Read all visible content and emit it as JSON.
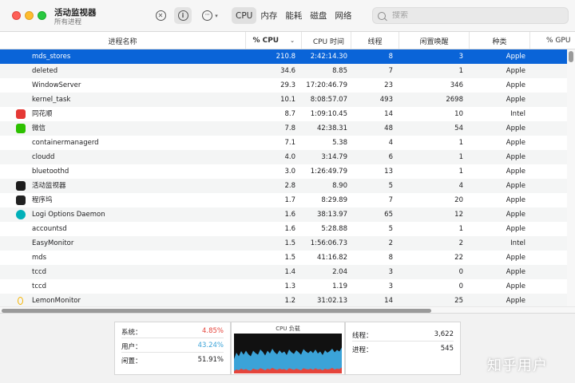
{
  "window": {
    "title": "活动监视器",
    "subtitle": "所有进程"
  },
  "toolbar": {
    "stop_icon": "xmark-circle-icon",
    "info_icon": "info-circle-icon",
    "more_icon": "ellipsis-circle-icon",
    "stop_glyph": "✕",
    "info_glyph": "i",
    "more_glyph": "···",
    "chevron": "▾"
  },
  "tabs": [
    {
      "label": "CPU",
      "active": true
    },
    {
      "label": "内存",
      "active": false
    },
    {
      "label": "能耗",
      "active": false
    },
    {
      "label": "磁盘",
      "active": false
    },
    {
      "label": "网络",
      "active": false
    }
  ],
  "search": {
    "placeholder": "搜索"
  },
  "columns": {
    "name": "进程名称",
    "cpu": "% CPU",
    "cpu_sort": "⌄",
    "cpu_time": "CPU 时间",
    "threads": "线程",
    "idle_wakeups": "闲置唤醒",
    "kind": "种类",
    "gpu": "% GPU"
  },
  "processes": [
    {
      "name": "mds_stores",
      "icon": "",
      "cpu": "210.8",
      "time": "2:42:14.30",
      "threads": "8",
      "wakeups": "3",
      "kind": "Apple",
      "selected": true
    },
    {
      "name": "deleted",
      "icon": "",
      "cpu": "34.6",
      "time": "8.85",
      "threads": "7",
      "wakeups": "1",
      "kind": "Apple"
    },
    {
      "name": "WindowServer",
      "icon": "",
      "cpu": "29.3",
      "time": "17:20:46.79",
      "threads": "23",
      "wakeups": "346",
      "kind": "Apple"
    },
    {
      "name": "kernel_task",
      "icon": "",
      "cpu": "10.1",
      "time": "8:08:57.07",
      "threads": "493",
      "wakeups": "2698",
      "kind": "Apple"
    },
    {
      "name": "同花顺",
      "icon": "tonghuashun-icon",
      "cpu": "8.7",
      "time": "1:09:10.45",
      "threads": "14",
      "wakeups": "10",
      "kind": "Intel"
    },
    {
      "name": "微信",
      "icon": "wechat-icon",
      "cpu": "7.8",
      "time": "42:38.31",
      "threads": "48",
      "wakeups": "54",
      "kind": "Apple"
    },
    {
      "name": "containermanagerd",
      "icon": "",
      "cpu": "7.1",
      "time": "5.38",
      "threads": "4",
      "wakeups": "1",
      "kind": "Apple"
    },
    {
      "name": "cloudd",
      "icon": "",
      "cpu": "4.0",
      "time": "3:14.79",
      "threads": "6",
      "wakeups": "1",
      "kind": "Apple"
    },
    {
      "name": "bluetoothd",
      "icon": "",
      "cpu": "3.0",
      "time": "1:26:49.79",
      "threads": "13",
      "wakeups": "1",
      "kind": "Apple"
    },
    {
      "name": "活动监视器",
      "icon": "activity-monitor-icon",
      "cpu": "2.8",
      "time": "8.90",
      "threads": "5",
      "wakeups": "4",
      "kind": "Apple"
    },
    {
      "name": "程序坞",
      "icon": "dock-icon",
      "cpu": "1.7",
      "time": "8:29.89",
      "threads": "7",
      "wakeups": "20",
      "kind": "Apple"
    },
    {
      "name": "Logi Options Daemon",
      "icon": "logi-icon",
      "cpu": "1.6",
      "time": "38:13.97",
      "threads": "65",
      "wakeups": "12",
      "kind": "Apple"
    },
    {
      "name": "accountsd",
      "icon": "",
      "cpu": "1.6",
      "time": "5:28.88",
      "threads": "5",
      "wakeups": "1",
      "kind": "Apple"
    },
    {
      "name": "EasyMonitor",
      "icon": "",
      "cpu": "1.5",
      "time": "1:56:06.73",
      "threads": "2",
      "wakeups": "2",
      "kind": "Intel"
    },
    {
      "name": "mds",
      "icon": "",
      "cpu": "1.5",
      "time": "41:16.82",
      "threads": "8",
      "wakeups": "22",
      "kind": "Apple"
    },
    {
      "name": "tccd",
      "icon": "",
      "cpu": "1.4",
      "time": "2.04",
      "threads": "3",
      "wakeups": "0",
      "kind": "Apple"
    },
    {
      "name": "tccd",
      "icon": "",
      "cpu": "1.3",
      "time": "1.19",
      "threads": "3",
      "wakeups": "0",
      "kind": "Apple"
    },
    {
      "name": "LemonMonitor",
      "icon": "lemon-icon",
      "cpu": "1.2",
      "time": "31:02.13",
      "threads": "14",
      "wakeups": "25",
      "kind": "Apple"
    }
  ],
  "stats": {
    "system_label": "系统：",
    "system_value": "4.85%",
    "user_label": "用户：",
    "user_value": "43.24%",
    "idle_label": "闲置：",
    "idle_value": "51.91%",
    "graph_title": "CPU 负载",
    "threads_label": "线程：",
    "threads_value": "3,622",
    "processes_label": "进程：",
    "processes_value": "545"
  },
  "colors": {
    "selection": "#0a64d8",
    "system_red": "#e5453c",
    "user_blue": "#3ba3d8"
  },
  "cpu_load_graph": {
    "user": [
      0.3,
      0.42,
      0.35,
      0.44,
      0.38,
      0.46,
      0.4,
      0.36,
      0.45,
      0.41,
      0.38,
      0.47,
      0.43,
      0.37,
      0.45,
      0.4,
      0.48,
      0.42,
      0.39,
      0.46,
      0.41,
      0.44,
      0.38,
      0.47,
      0.42,
      0.4,
      0.46,
      0.43,
      0.39,
      0.48,
      0.44,
      0.41,
      0.45,
      0.42,
      0.47,
      0.4,
      0.44,
      0.38,
      0.46,
      0.42,
      0.45,
      0.48,
      0.43,
      0.47,
      0.44,
      0.5
    ],
    "system": [
      0.06,
      0.1,
      0.08,
      0.12,
      0.09,
      0.11,
      0.08,
      0.07,
      0.12,
      0.1,
      0.09,
      0.13,
      0.11,
      0.08,
      0.12,
      0.1,
      0.14,
      0.11,
      0.09,
      0.12,
      0.1,
      0.11,
      0.08,
      0.13,
      0.11,
      0.09,
      0.12,
      0.1,
      0.08,
      0.13,
      0.11,
      0.1,
      0.12,
      0.09,
      0.13,
      0.1,
      0.11,
      0.08,
      0.12,
      0.1,
      0.11,
      0.14,
      0.1,
      0.12,
      0.11,
      0.15
    ]
  },
  "watermark": "知乎用户"
}
